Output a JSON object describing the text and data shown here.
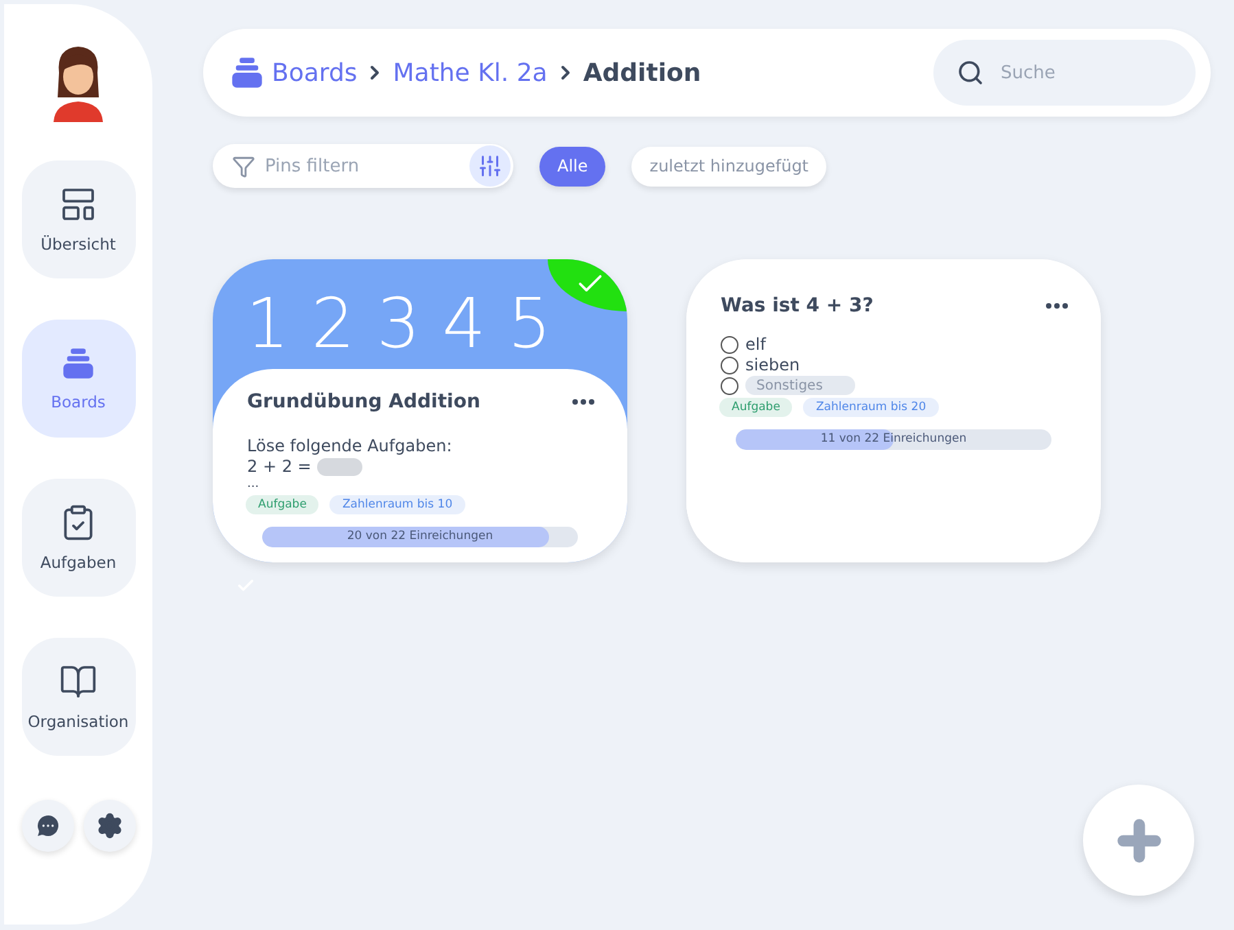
{
  "sidebar": {
    "items": [
      {
        "label": "Übersicht",
        "selected": false
      },
      {
        "label": "Boards",
        "selected": true
      },
      {
        "label": "Aufgaben",
        "selected": false
      },
      {
        "label": "Organisation",
        "selected": false
      }
    ]
  },
  "breadcrumb": [
    {
      "label": "Boards",
      "current": false
    },
    {
      "label": "Mathe Kl. 2a",
      "current": false
    },
    {
      "label": "Addition",
      "current": true
    }
  ],
  "search": {
    "placeholder": "Suche"
  },
  "filter": {
    "placeholder": "Pins filtern"
  },
  "sort_chips": [
    {
      "label": "Alle",
      "selected": true
    },
    {
      "label": "zuletzt hinzugefügt",
      "selected": false
    }
  ],
  "pins": [
    {
      "kind": "text",
      "cover": "1 2 3 4 5",
      "done": true,
      "title": "Grundübung Addition",
      "lines": [
        "Löse folgende Aufgaben:",
        "2 + 2 =",
        "..."
      ],
      "tags": [
        {
          "label": "Aufgabe",
          "color": "#2e9e6e"
        },
        {
          "label": "Zahlenraum bis 10",
          "color": "#4f86e8"
        }
      ],
      "progress": {
        "level": 0.91,
        "reading": "20 von 22 Einreichungen"
      }
    },
    {
      "kind": "choice",
      "done": false,
      "title": "Was ist 4 + 3?",
      "options": [
        {
          "label": "elf",
          "selected": false
        },
        {
          "label": "sieben",
          "selected": false
        }
      ],
      "other": {
        "placeholder": "Sonstiges",
        "selected": false
      },
      "tags": [
        {
          "label": "Aufgabe",
          "color": "#2e9e6e"
        },
        {
          "label": "Zahlenraum bis 20",
          "color": "#4f86e8"
        }
      ],
      "progress": {
        "level": 0.5,
        "reading": "11 von 22 Einreichungen"
      }
    }
  ]
}
